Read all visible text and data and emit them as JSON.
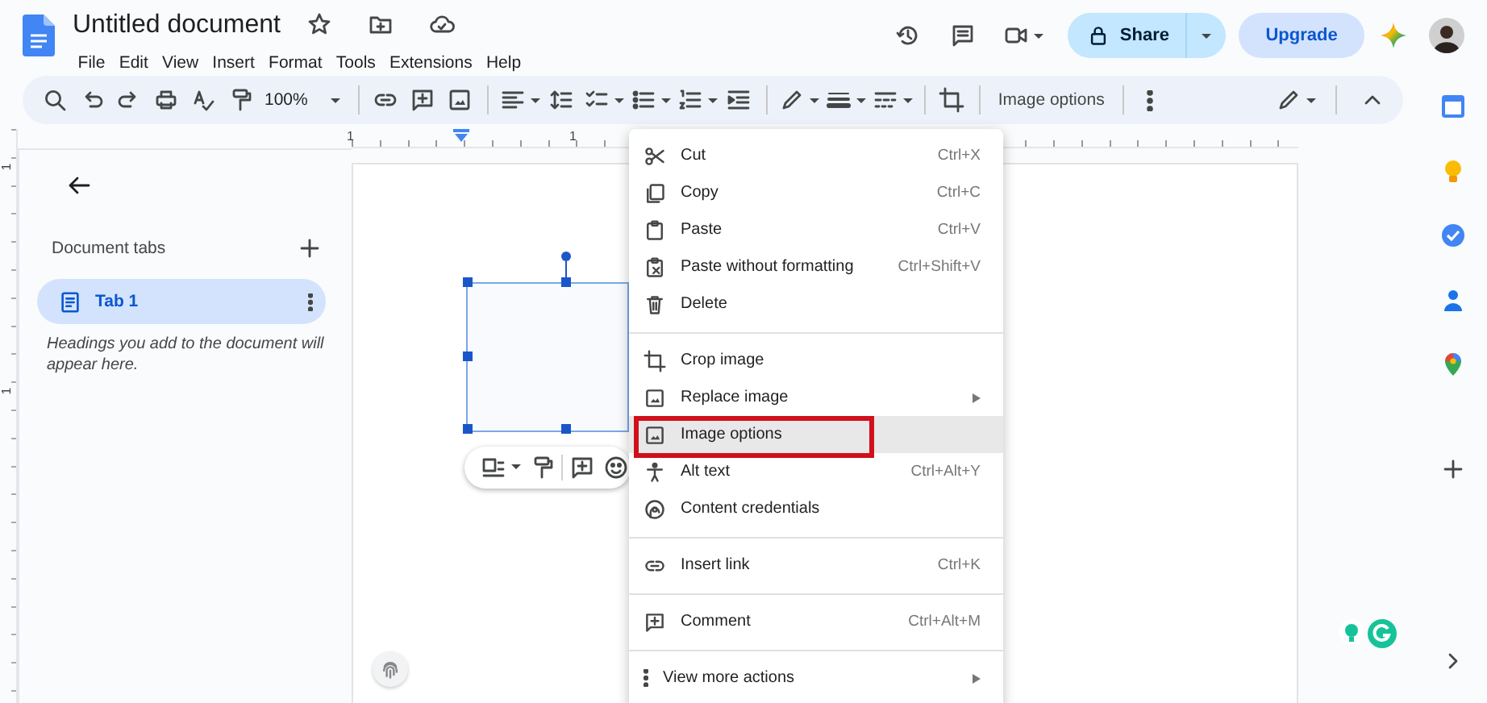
{
  "header": {
    "title": "Untitled document",
    "menus": [
      "File",
      "Edit",
      "View",
      "Insert",
      "Format",
      "Tools",
      "Extensions",
      "Help"
    ],
    "share": "Share",
    "upgrade": "Upgrade"
  },
  "toolbar": {
    "zoom": "100%",
    "image_options": "Image options"
  },
  "ruler": {
    "top_labels": [
      "1",
      "1"
    ],
    "side_labels": [
      "1",
      "1"
    ]
  },
  "sidebar": {
    "heading": "Document tabs",
    "tabs": [
      {
        "label": "Tab 1",
        "selected": true
      }
    ],
    "hint": "Headings you add to the document will appear here."
  },
  "context_menu": {
    "items": [
      {
        "kind": "item",
        "label": "Cut",
        "shortcut": "Ctrl+X",
        "submenu": false,
        "selected": false
      },
      {
        "kind": "item",
        "label": "Copy",
        "shortcut": "Ctrl+C",
        "submenu": false,
        "selected": false
      },
      {
        "kind": "item",
        "label": "Paste",
        "shortcut": "Ctrl+V",
        "submenu": false,
        "selected": false
      },
      {
        "kind": "item",
        "label": "Paste without formatting",
        "shortcut": "Ctrl+Shift+V",
        "submenu": false,
        "selected": false
      },
      {
        "kind": "item",
        "label": "Delete",
        "submenu": false,
        "selected": false
      },
      {
        "kind": "separator"
      },
      {
        "kind": "item",
        "label": "Crop image",
        "submenu": false,
        "selected": false
      },
      {
        "kind": "item",
        "label": "Replace image",
        "submenu": true,
        "selected": false
      },
      {
        "kind": "item",
        "label": "Image options",
        "submenu": false,
        "selected": true
      },
      {
        "kind": "item",
        "label": "Alt text",
        "shortcut": "Ctrl+Alt+Y",
        "submenu": false,
        "selected": false
      },
      {
        "kind": "item",
        "label": "Content credentials",
        "submenu": false,
        "selected": false
      },
      {
        "kind": "separator"
      },
      {
        "kind": "item",
        "label": "Insert link",
        "shortcut": "Ctrl+K",
        "submenu": false,
        "selected": false
      },
      {
        "kind": "separator"
      },
      {
        "kind": "item",
        "label": "Comment",
        "shortcut": "Ctrl+Alt+M",
        "submenu": false,
        "selected": false
      },
      {
        "kind": "separator"
      },
      {
        "kind": "item",
        "label": "View more actions",
        "submenu": true,
        "selected": false
      }
    ]
  }
}
